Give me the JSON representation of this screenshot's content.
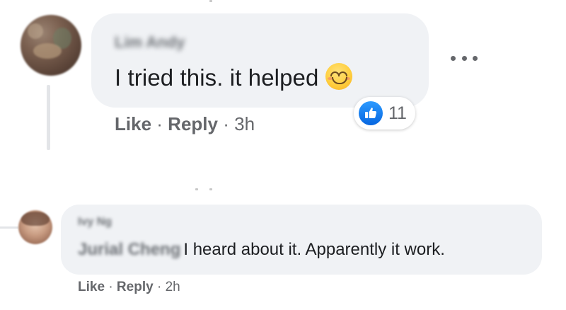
{
  "comments": [
    {
      "author": "Lim Andy",
      "text": "I tried this. it helped",
      "emoji_icon": "smiling-face-icon",
      "reaction": {
        "icon": "like-icon",
        "count": "11",
        "color": "#1877f2"
      },
      "actions": {
        "like": "Like",
        "reply": "Reply",
        "time": "3h",
        "separator": "·"
      }
    },
    {
      "author": "Ivy Ng",
      "mention": "Jurial Cheng",
      "text": "I heard about it. Apparently it work.",
      "actions": {
        "like": "Like",
        "reply": "Reply",
        "time": "2h",
        "separator": "·"
      }
    }
  ],
  "colors": {
    "bubble": "#f0f2f5",
    "text_primary": "#1c1e21",
    "text_secondary": "#65676b",
    "like_blue": "#1877f2"
  }
}
